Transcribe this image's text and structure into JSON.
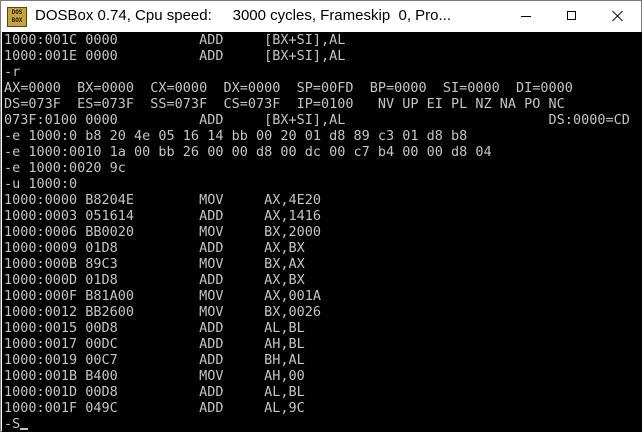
{
  "window": {
    "icon_label": "DOS BOX",
    "title": "DOSBox 0.74, Cpu speed:     3000 cycles, Frameskip  0, Pro..."
  },
  "console": {
    "lines": [
      "1000:001C 0000          ADD     [BX+SI],AL",
      "1000:001E 0000          ADD     [BX+SI],AL",
      "-r",
      "AX=0000  BX=0000  CX=0000  DX=0000  SP=00FD  BP=0000  SI=0000  DI=0000",
      "DS=073F  ES=073F  SS=073F  CS=073F  IP=0100   NV UP EI PL NZ NA PO NC",
      "073F:0100 0000          ADD     [BX+SI],AL                         DS:0000=CD",
      "-e 1000:0 b8 20 4e 05 16 14 bb 00 20 01 d8 89 c3 01 d8 b8",
      "-e 1000:0010 1a 00 bb 26 00 00 d8 00 dc 00 c7 b4 00 00 d8 04",
      "-e 1000:0020 9c",
      "-u 1000:0",
      "1000:0000 B8204E        MOV     AX,4E20",
      "1000:0003 051614        ADD     AX,1416",
      "1000:0006 BB0020        MOV     BX,2000",
      "1000:0009 01D8          ADD     AX,BX",
      "1000:000B 89C3          MOV     BX,AX",
      "1000:000D 01D8          ADD     AX,BX",
      "1000:000F B81A00        MOV     AX,001A",
      "1000:0012 BB2600        MOV     BX,0026",
      "1000:0015 00D8          ADD     AL,BL",
      "1000:0017 00DC          ADD     AH,BL",
      "1000:0019 00C7          ADD     BH,AL",
      "1000:001B B400          MOV     AH,00",
      "1000:001D 00D8          ADD     AL,BL",
      "1000:001F 049C          ADD     AL,9C",
      "-S"
    ]
  },
  "colors": {
    "console_bg": "#000000",
    "console_fg": "#c4c4c4",
    "titlebar_bg": "#ffffff"
  },
  "icons": [
    "dosbox-app-icon",
    "minimize-icon",
    "maximize-icon",
    "close-icon"
  ]
}
